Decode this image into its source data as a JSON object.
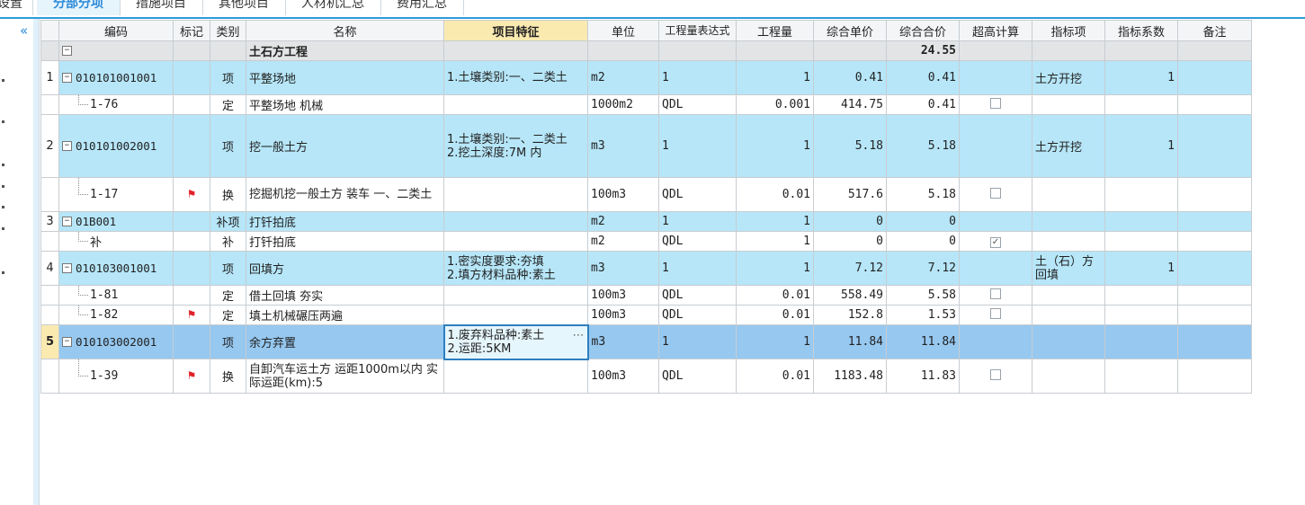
{
  "tabs": [
    {
      "label": "设置"
    },
    {
      "label": "分部分项"
    },
    {
      "label": "措施项目"
    },
    {
      "label": "其他项目"
    },
    {
      "label": "人材机汇总"
    },
    {
      "label": "费用汇总"
    }
  ],
  "columns": {
    "code": "编码",
    "mark": "标记",
    "type": "类别",
    "name": "名称",
    "feature": "项目特征",
    "unit": "单位",
    "expr": "工程量表达式",
    "qty": "工程量",
    "uprice": "综合单价",
    "total": "综合合价",
    "over": "超高计算",
    "indicator": "指标项",
    "coef": "指标系数",
    "note": "备注"
  },
  "group": {
    "name": "土石方工程",
    "total": "24.55"
  },
  "rows": [
    {
      "idx": "1",
      "code": "010101001001",
      "type": "项",
      "name": "平整场地",
      "feature": "1.土壤类别:一、二类土",
      "unit": "m2",
      "expr": "1",
      "qty": "1",
      "uprice": "0.41",
      "total": "0.41",
      "indicator": "土方开挖",
      "coef": "1"
    },
    {
      "code": "1-76",
      "type": "定",
      "name": "平整场地 机械",
      "unit": "1000m2",
      "expr": "QDL",
      "qty": "0.001",
      "uprice": "414.75",
      "total": "0.41"
    },
    {
      "idx": "2",
      "code": "010101002001",
      "type": "项",
      "name": "挖一般土方",
      "feature": "1.土壤类别:一、二类土\n2.挖土深度:7M 内",
      "unit": "m3",
      "expr": "1",
      "qty": "1",
      "uprice": "5.18",
      "total": "5.18",
      "indicator": "土方开挖",
      "coef": "1"
    },
    {
      "code": "1-17",
      "type": "换",
      "name": "挖掘机挖一般土方 装车 一、二类土",
      "unit": "100m3",
      "expr": "QDL",
      "qty": "0.01",
      "uprice": "517.6",
      "total": "5.18"
    },
    {
      "idx": "3",
      "code": "01B001",
      "type": "补项",
      "name": "打钎拍底",
      "unit": "m2",
      "expr": "1",
      "qty": "1",
      "uprice": "0",
      "total": "0"
    },
    {
      "code": "补",
      "type": "补",
      "name": "打钎拍底",
      "unit": "m2",
      "expr": "QDL",
      "qty": "1",
      "uprice": "0",
      "total": "0"
    },
    {
      "idx": "4",
      "code": "010103001001",
      "type": "项",
      "name": "回填方",
      "feature": "1.密实度要求:夯填\n2.填方材料品种:素土",
      "unit": "m3",
      "expr": "1",
      "qty": "1",
      "uprice": "7.12",
      "total": "7.12",
      "indicator": "土（石）方回填",
      "coef": "1"
    },
    {
      "code": "1-81",
      "type": "定",
      "name": "借土回填 夯实",
      "unit": "100m3",
      "expr": "QDL",
      "qty": "0.01",
      "uprice": "558.49",
      "total": "5.58"
    },
    {
      "code": "1-82",
      "type": "定",
      "name": "填土机械碾压两遍",
      "unit": "100m3",
      "expr": "QDL",
      "qty": "0.01",
      "uprice": "152.8",
      "total": "1.53"
    },
    {
      "idx": "5",
      "code": "010103002001",
      "type": "项",
      "name": "余方弃置",
      "feature": "1.废弃料品种:素土\n2.运距:5KM",
      "unit": "m3",
      "expr": "1",
      "qty": "1",
      "uprice": "11.84",
      "total": "11.84"
    },
    {
      "code": "1-39",
      "type": "换",
      "name": "自卸汽车运土方 运距1000m以内  实际运距(km):5",
      "unit": "100m3",
      "expr": "QDL",
      "qty": "0.01",
      "uprice": "1183.48",
      "total": "11.83"
    }
  ],
  "icons": {
    "collapse": "double-chevron-left-icon",
    "flag": "red-flag-icon"
  }
}
